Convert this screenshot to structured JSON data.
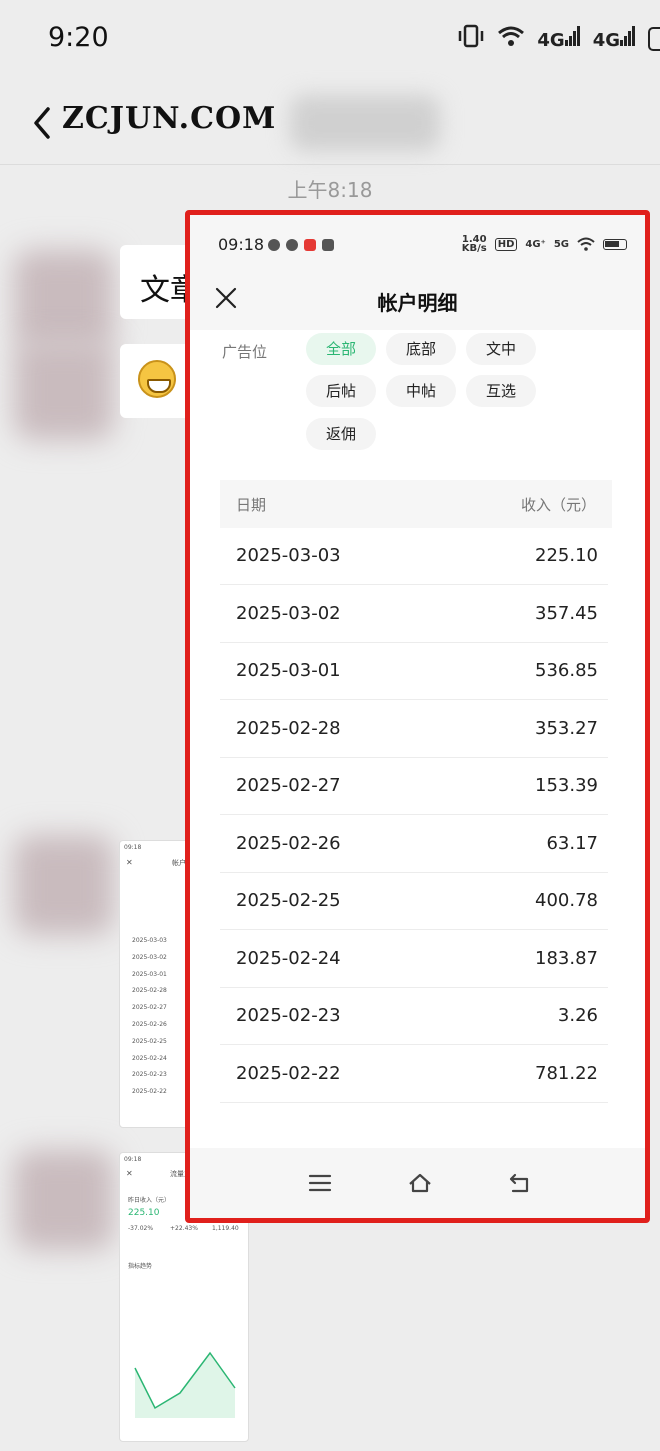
{
  "outer_status": {
    "time": "9:20",
    "net1": "4G",
    "net2": "4G"
  },
  "chat": {
    "title": "ZCJUN.COM",
    "timestamp": "上午8:18"
  },
  "bubbles": {
    "text_fragment": "文章"
  },
  "thumbnail1": {
    "title": "帐户明",
    "dates": [
      "2025-03-03",
      "2025-03-02",
      "2025-03-01",
      "2025-02-28",
      "2025-02-27",
      "2025-02-26",
      "2025-02-25",
      "2025-02-24",
      "2025-02-23",
      "2025-02-22"
    ]
  },
  "thumbnail2": {
    "title": "流量主",
    "label": "昨日收入（元）",
    "value": "225.10",
    "stat1": "-37.02%",
    "stat2": "+22.43%",
    "stat3": "1,119.40",
    "section": "指标趋势"
  },
  "panel": {
    "status": {
      "time": "09:18",
      "speed_top": "1.40",
      "speed_unit": "KB/s",
      "hd": "HD",
      "net1": "4G⁺",
      "net2": "5G"
    },
    "title": "帐户明细",
    "filter_label": "广告位",
    "chips": [
      "全部",
      "底部",
      "文中",
      "后帖",
      "中帖",
      "互选",
      "返佣"
    ],
    "table": {
      "col_date": "日期",
      "col_income": "收入（元）",
      "rows": [
        {
          "date": "2025-03-03",
          "value": "225.10"
        },
        {
          "date": "2025-03-02",
          "value": "357.45"
        },
        {
          "date": "2025-03-01",
          "value": "536.85"
        },
        {
          "date": "2025-02-28",
          "value": "353.27"
        },
        {
          "date": "2025-02-27",
          "value": "153.39"
        },
        {
          "date": "2025-02-26",
          "value": "63.17"
        },
        {
          "date": "2025-02-25",
          "value": "400.78"
        },
        {
          "date": "2025-02-24",
          "value": "183.87"
        },
        {
          "date": "2025-02-23",
          "value": "3.26"
        },
        {
          "date": "2025-02-22",
          "value": "781.22"
        }
      ]
    }
  },
  "colors": {
    "accent": "#2bb673",
    "frame": "#e0201c"
  },
  "icons": [
    "back-icon",
    "close-icon",
    "menu-icon",
    "home-icon",
    "return-icon",
    "wifi-icon",
    "signal-icon",
    "battery-icon",
    "vibrate-icon"
  ]
}
